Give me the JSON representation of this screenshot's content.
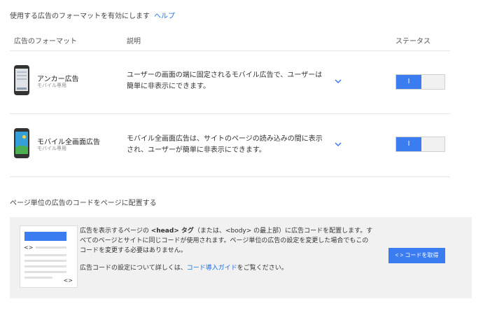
{
  "header": {
    "title": "使用する広告のフォーマットを有効にします",
    "help_label": "ヘルプ"
  },
  "table": {
    "columns": [
      "広告のフォーマット",
      "説明",
      "ステータス"
    ],
    "rows": [
      {
        "name": "アンカー広告",
        "sub": "モバイル専用",
        "desc": "ユーザーの画面の端に固定されるモバイル広告で、ユーザーは簡単に非表示にできます。",
        "toggle_label": "I",
        "enabled": true,
        "icon": "anchor-phone-icon"
      },
      {
        "name": "モバイル全画面広告",
        "sub": "モバイル専用",
        "desc": "モバイル全画面広告は、サイトのページの読み込みの間に表示され、ユーザーが簡単に非表示にできます。",
        "toggle_label": "I",
        "enabled": true,
        "icon": "fullscreen-phone-icon"
      }
    ]
  },
  "code_section": {
    "title": "ページ単位の広告のコードをページに配置する",
    "text_before": "広告を表示するページの ",
    "text_bold": "<head> タグ",
    "text_after": "（または、<body> の最上部）に広告コードを配置します。すべてのページとサイトに同じコードが使用されます。ページ単位の広告の設定を変更した場合でもこのコードを変更する必要はありません。",
    "more_before": "広告コードの設定について詳しくは、",
    "more_link": "コード導入ガイド",
    "more_after": "をご覧ください。",
    "illus_code": "<>",
    "button_label": "< > コードを取得"
  },
  "colors": {
    "accent": "#3b7cf0",
    "link": "#1a73e8",
    "panel_bg": "#f1f1f1"
  }
}
